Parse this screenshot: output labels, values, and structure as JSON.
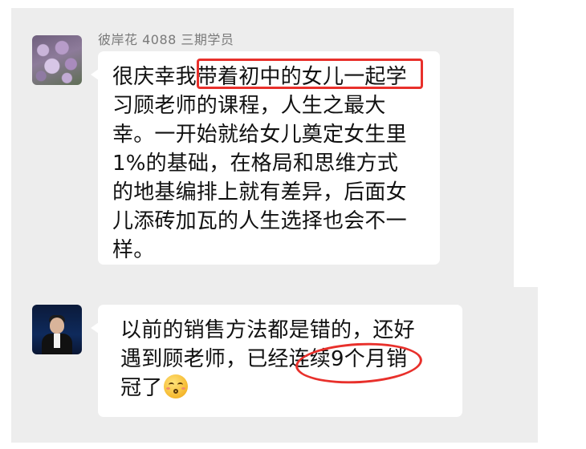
{
  "chat": {
    "messages": [
      {
        "sender": "彼岸花 4088 三期学员",
        "lines": [
          "很庆幸我带着初中的女儿一起学",
          "习顾老师的课程，人生之最大",
          "幸。一开始就给女儿奠定女生里",
          "1%的基础，在格局和思维方式",
          "的地基编排上就有差异，后面女",
          "儿添砖加瓦的人生选择也会不一",
          "样。"
        ],
        "highlight": "带着初中的女儿一起学"
      },
      {
        "sender": "",
        "lines": [
          "以前的销售方法都是错的，还好",
          "遇到顾老师，已经连续9个月销",
          "冠了"
        ],
        "highlight": "连续9个月",
        "emoji": "smiling-face-icon"
      }
    ]
  },
  "colors": {
    "background": "#ededed",
    "bubble": "#ffffff",
    "annotation": "#e8302b"
  }
}
